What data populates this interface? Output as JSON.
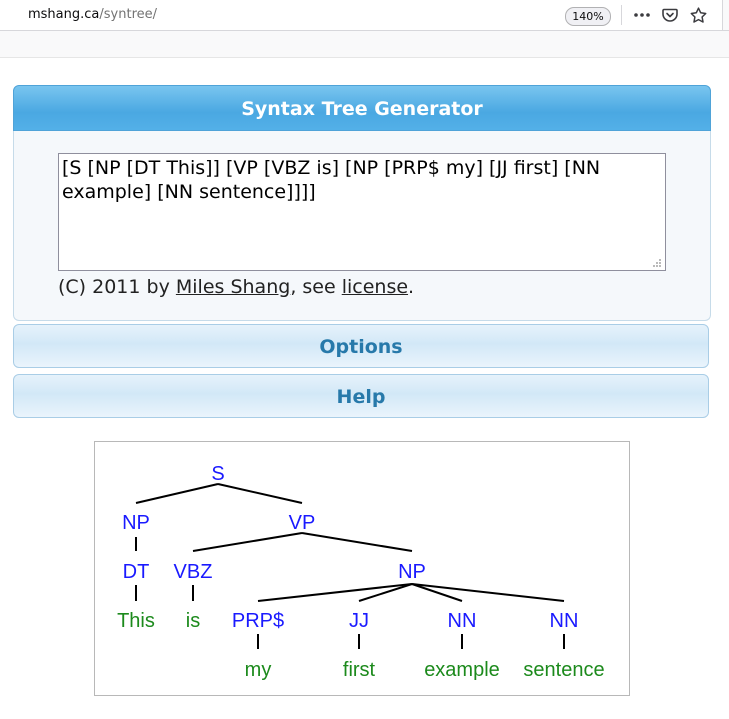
{
  "browser": {
    "url_host": "mshang.ca",
    "url_path": "/syntree/",
    "zoom": "140%"
  },
  "app": {
    "title": "Syntax Tree Generator",
    "input_value": "[S [NP [DT This]] [VP [VBZ is] [NP [PRP$ my] [JJ first] [NN example] [NN sentence]]]]",
    "copyright_prefix": "(C) 2011 by ",
    "author": "Miles Shang",
    "copyright_mid": ", see ",
    "license": "license",
    "copyright_suffix": "."
  },
  "sections": {
    "options": "Options",
    "help": "Help"
  },
  "tree": {
    "nodes": {
      "s": "S",
      "np1": "NP",
      "vp": "VP",
      "dt": "DT",
      "vbz": "VBZ",
      "np2": "NP",
      "prp": "PRP$",
      "jj": "JJ",
      "nn1": "NN",
      "nn2": "NN"
    },
    "leaves": {
      "this": "This",
      "is": "is",
      "my": "my",
      "first": "first",
      "example": "example",
      "sentence": "sentence"
    }
  },
  "colors": {
    "nonterminal": "#1a1aff",
    "terminal": "#1c8a1c",
    "header_blue": "#4aa8e2",
    "accordion_text": "#2779aa"
  },
  "icons": [
    "more-icon",
    "pocket-icon",
    "bookmark-star-icon"
  ]
}
